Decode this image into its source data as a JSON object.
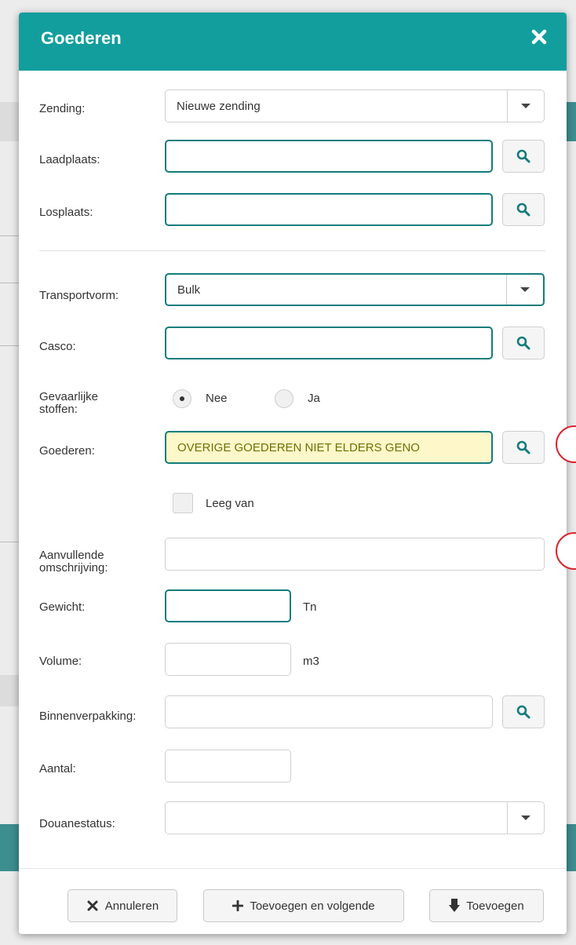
{
  "modal": {
    "title": "Goederen"
  },
  "form": {
    "zending": {
      "label": "Zending:",
      "value": "Nieuwe zending"
    },
    "laadplaats": {
      "label": "Laadplaats:",
      "value": ""
    },
    "losplaats": {
      "label": "Losplaats:",
      "value": ""
    },
    "transportvorm": {
      "label": "Transportvorm:",
      "value": "Bulk"
    },
    "casco": {
      "label": "Casco:",
      "value": ""
    },
    "gevaarlijke": {
      "label_line1": "Gevaarlijke",
      "label_line2": "stoffen:",
      "options": [
        {
          "label": "Nee",
          "selected": true
        },
        {
          "label": "Ja",
          "selected": false
        }
      ]
    },
    "goederen": {
      "label": "Goederen:",
      "value": "OVERIGE GOEDEREN NIET ELDERS GENO"
    },
    "leeg_van": {
      "label": "Leeg van",
      "checked": false
    },
    "aanvullende": {
      "label_line1": "Aanvullende",
      "label_line2": "omschrijving:",
      "value": ""
    },
    "gewicht": {
      "label": "Gewicht:",
      "value": "",
      "unit": "Tn"
    },
    "volume": {
      "label": "Volume:",
      "value": "",
      "unit": "m3"
    },
    "binnenverpakking": {
      "label": "Binnenverpakking:",
      "value": ""
    },
    "aantal": {
      "label": "Aantal:",
      "value": ""
    },
    "douanestatus": {
      "label": "Douanestatus:",
      "value": ""
    }
  },
  "footer": {
    "cancel_label": "Annuleren",
    "add_next_label": "Toevoegen en volgende",
    "add_label": "Toevoegen"
  },
  "colors": {
    "header": "#139e9e",
    "focus_border": "#137c7c",
    "highlight_bg": "#fdf7c9",
    "marker": "#d8262e"
  }
}
